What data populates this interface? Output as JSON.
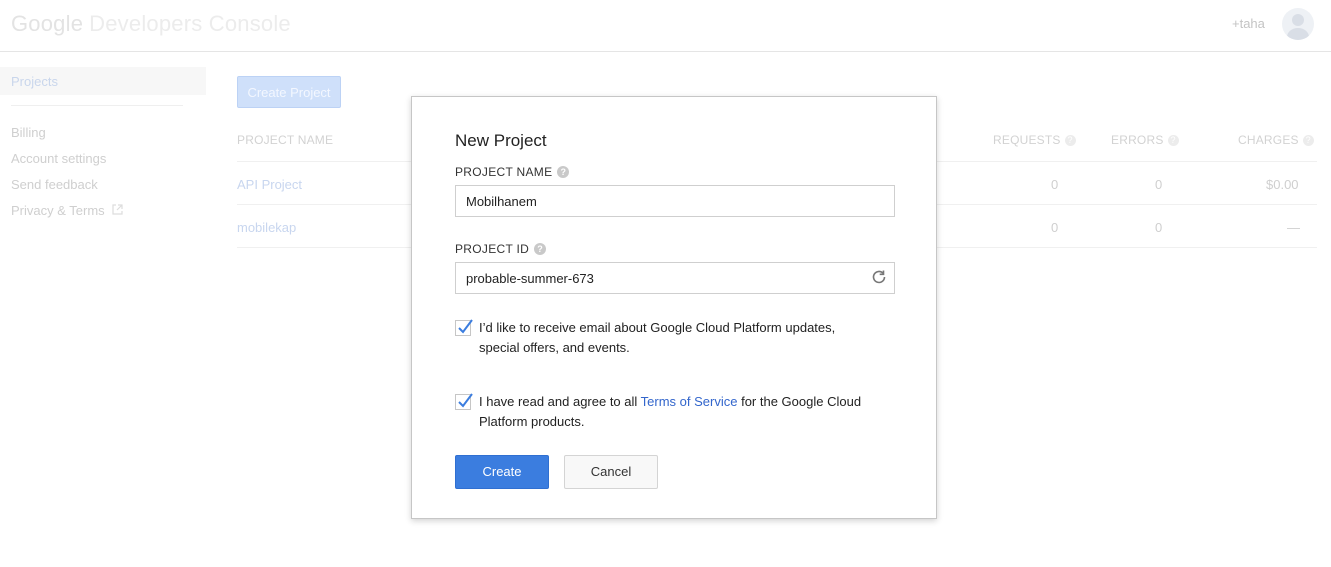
{
  "header": {
    "logo_google": "Google",
    "logo_rest": "Developers Console",
    "user_name": "+taha"
  },
  "sidebar": {
    "active": "Projects",
    "items": [
      "Billing",
      "Account settings",
      "Send feedback",
      "Privacy & Terms"
    ]
  },
  "main": {
    "create_button": "Create Project",
    "columns": {
      "project_name": "PROJECT NAME",
      "requests": "REQUESTS",
      "errors": "ERRORS",
      "charges": "CHARGES"
    },
    "rows": [
      {
        "name": "API Project",
        "requests": "0",
        "errors": "0",
        "charges": "$0.00"
      },
      {
        "name": "mobilekap",
        "requests": "0",
        "errors": "0",
        "charges": "—"
      }
    ]
  },
  "dialog": {
    "title": "New Project",
    "project_name_label": "PROJECT NAME",
    "project_name_value": "Mobilhanem",
    "project_id_label": "PROJECT ID",
    "project_id_value": "probable-summer-673",
    "email_checkbox_text": "I’d like to receive email about Google Cloud Platform updates, special offers, and events.",
    "email_checked": true,
    "tos_prefix": "I have read and agree to all ",
    "tos_link": "Terms of Service",
    "tos_suffix": " for the Google Cloud Platform products.",
    "tos_checked": true,
    "create_label": "Create",
    "cancel_label": "Cancel"
  },
  "colors": {
    "primary": "#3b7ddf",
    "link": "#3366cc"
  }
}
